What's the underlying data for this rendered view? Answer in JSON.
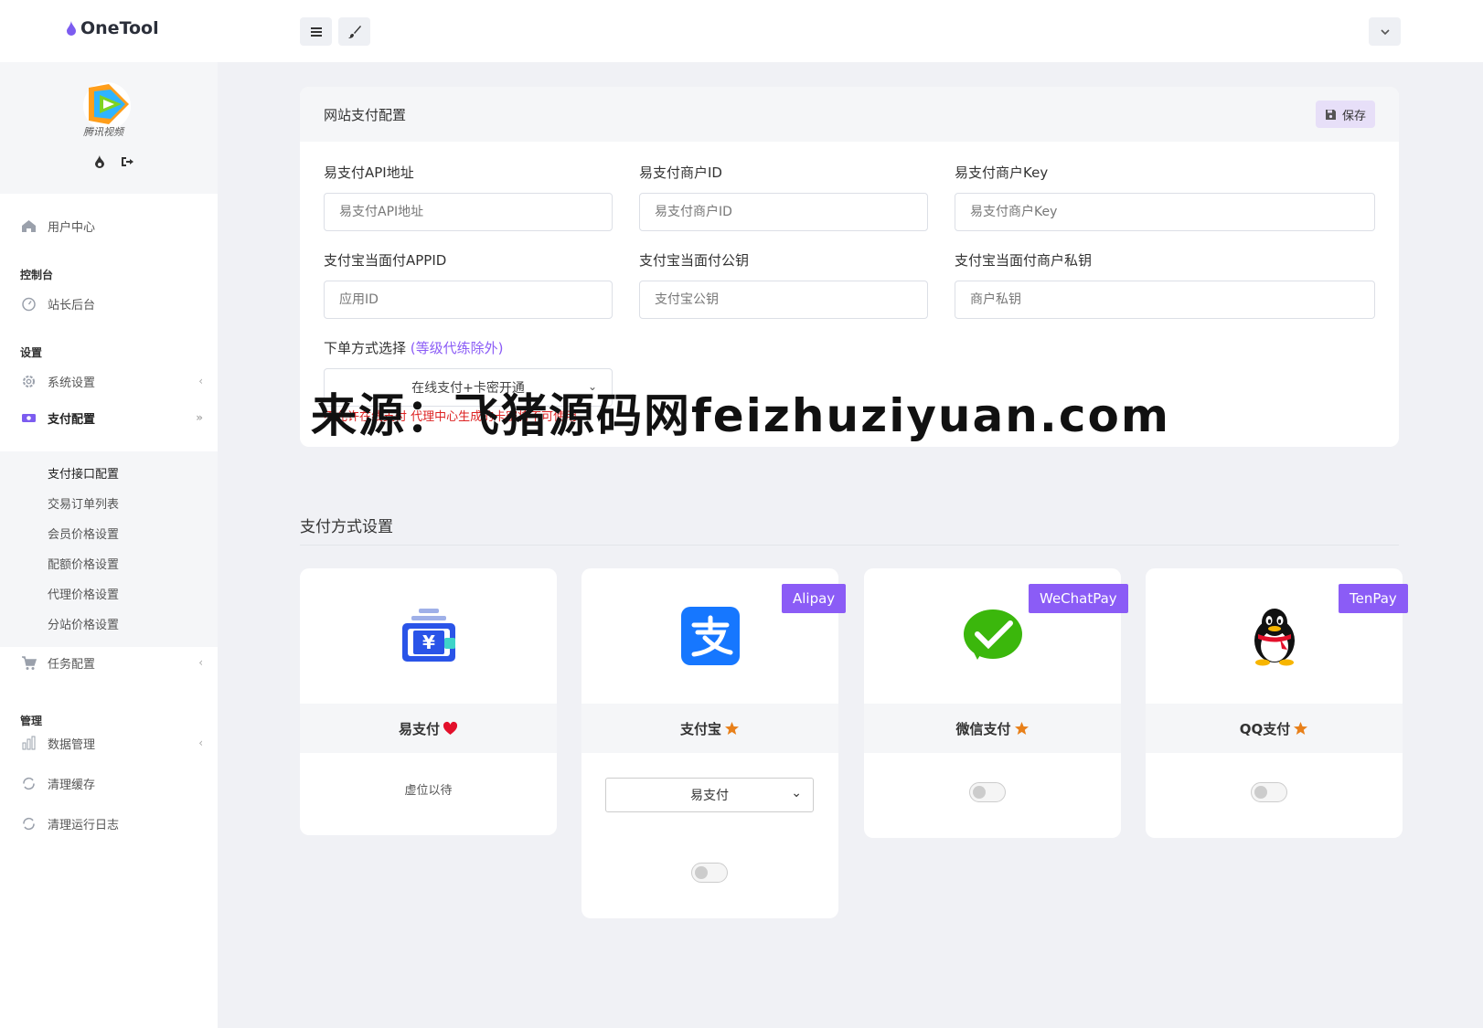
{
  "app": {
    "name": "OneTool",
    "avatar_caption": "腾讯视频"
  },
  "sidebar": {
    "items": [
      {
        "label": "用户中心"
      },
      {
        "label": "站长后台"
      },
      {
        "label": "系统设置"
      },
      {
        "label": "支付配置"
      },
      {
        "label": "任务配置"
      },
      {
        "label": "数据管理"
      },
      {
        "label": "清理缓存"
      },
      {
        "label": "清理运行日志"
      }
    ],
    "sections": [
      "控制台",
      "设置",
      "管理"
    ],
    "submenu": [
      "支付接口配置",
      "交易订单列表",
      "会员价格设置",
      "配额价格设置",
      "代理价格设置",
      "分站价格设置"
    ]
  },
  "config": {
    "title": "网站支付配置",
    "save_label": "保存",
    "fields": [
      {
        "label": "易支付API地址",
        "placeholder": "易支付API地址"
      },
      {
        "label": "易支付商户ID",
        "placeholder": "易支付商户ID"
      },
      {
        "label": "易支付商户Key",
        "placeholder": "易支付商户Key"
      },
      {
        "label": "支付宝当面付APPID",
        "placeholder": "应用ID"
      },
      {
        "label": "支付宝当面付公钥",
        "placeholder": "支付宝公钥"
      },
      {
        "label": "支付宝当面付商户私钥",
        "placeholder": "商户私钥"
      }
    ],
    "order_label": "下单方式选择",
    "order_label_accent": "(等级代练除外)",
    "order_value": "在线支付+卡密开通",
    "hint": "不允许在线支付 代理中心生成的卡密将不可使用"
  },
  "watermark": "来源：飞猪源码网feizhuziyuan.com",
  "payment": {
    "section_title": "支付方式设置",
    "cards": [
      {
        "name": "易支付",
        "badge": "",
        "footer_text": "虚位以待"
      },
      {
        "name": "支付宝",
        "badge": "Alipay",
        "select_value": "易支付"
      },
      {
        "name": "微信支付",
        "badge": "WeChatPay"
      },
      {
        "name": "QQ支付",
        "badge": "TenPay"
      }
    ]
  },
  "colors": {
    "accent": "#8b5cf6",
    "alipay": "#1677ff",
    "wechat": "#3bb70c"
  }
}
